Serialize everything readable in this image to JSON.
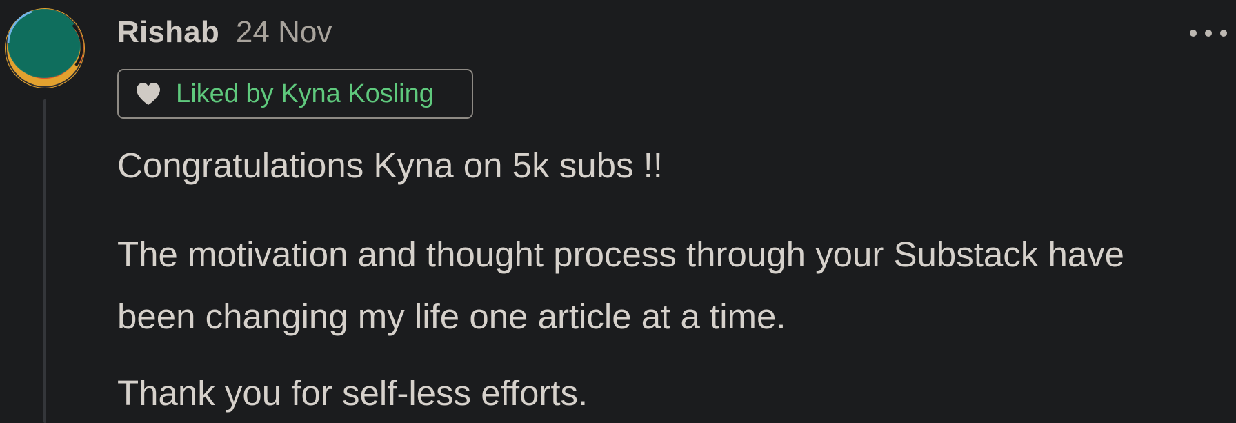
{
  "comment": {
    "author": "Rishab",
    "date": "24 Nov",
    "liked_badge": "Liked by Kyna Kosling",
    "paragraphs": {
      "p1": "Congratulations Kyna on 5k subs !!",
      "p2_line1": "The motivation and thought process through your Substack have",
      "p2_line2": "been changing my life one article at a time.",
      "p3": "Thank you for self-less efforts."
    }
  },
  "icons": {
    "avatar": "avatar",
    "heart": "heart-icon",
    "more": "more-options-icon"
  },
  "colors": {
    "background": "#1b1c1e",
    "text": "#d6d1cb",
    "muted": "#a8a39c",
    "liked_green": "#5fc97d",
    "badge_border": "#8e8a84"
  }
}
